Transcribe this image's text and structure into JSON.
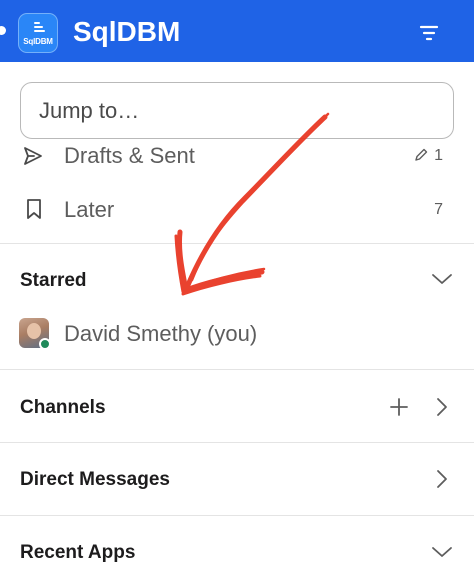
{
  "header": {
    "logo_text": "SqlDBM",
    "title": "SqlDBM",
    "background_color": "#1f63e6"
  },
  "search": {
    "placeholder": "Jump to…"
  },
  "quick_items": [
    {
      "label": "Drafts & Sent",
      "count": "1",
      "icon": "send-icon",
      "count_icon": "pencil-icon"
    },
    {
      "label": "Later",
      "count": "7",
      "icon": "bookmark-icon"
    }
  ],
  "sections": {
    "starred": {
      "title": "Starred",
      "state": "expanded"
    },
    "channels": {
      "title": "Channels",
      "state": "collapsed"
    },
    "direct_messages": {
      "title": "Direct Messages",
      "state": "collapsed"
    },
    "recent_apps": {
      "title": "Recent Apps",
      "state": "expanded"
    }
  },
  "starred_items": [
    {
      "label": "David Smethy (you)",
      "presence": "active"
    }
  ],
  "annotation": {
    "type": "hand-drawn arrow",
    "color": "#e8331e"
  }
}
